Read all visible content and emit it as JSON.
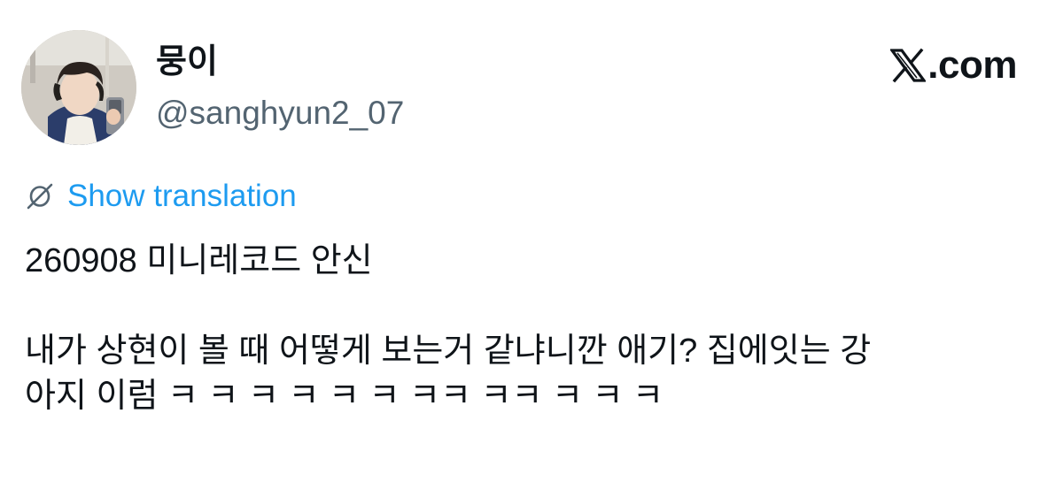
{
  "author": {
    "display_name": "뭉이",
    "handle": "@sanghyun2_07",
    "avatar_icon": "profile-photo"
  },
  "brand": {
    "logo_icon": "x-logo-icon",
    "label": ".com"
  },
  "translation": {
    "icon": "globe-slash-icon",
    "label": "Show translation",
    "color": "#1d9bf0"
  },
  "tweet": {
    "line1": "260908 미니레코드 안신",
    "line2": "내가 상현이 볼 때 어떻게 보는거 같냐니깐 애기? 집에잇는 강",
    "line3": "아지 이럼 ㅋ ㅋ ㅋ ㅋ ㅋ ㅋ ㅋㅋ ㅋㅋ ㅋ ㅋ ㅋ"
  },
  "colors": {
    "text_primary": "#0f1419",
    "text_secondary": "#536471",
    "link": "#1d9bf0",
    "background": "#ffffff"
  }
}
